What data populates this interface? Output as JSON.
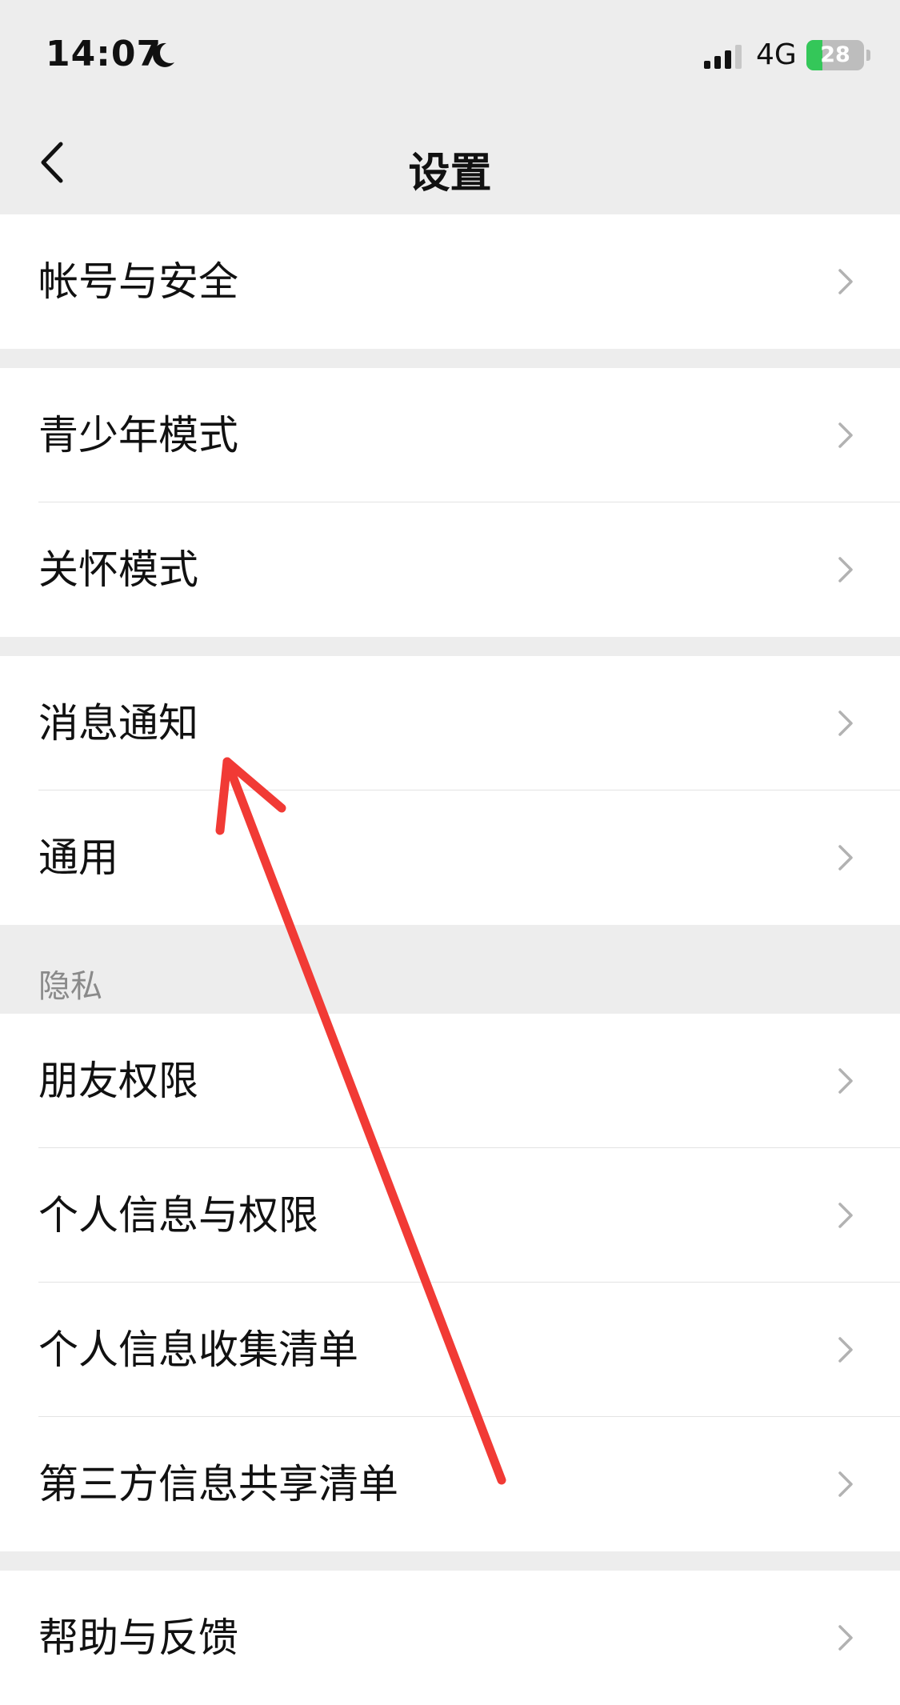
{
  "status_bar": {
    "time": "14:07",
    "moon_icon": "moon-icon",
    "signal_icon": "cellular-signal-icon",
    "network": "4G",
    "battery": {
      "text": "28",
      "level": 0.28,
      "color": "#34c759",
      "icon": "battery-charging-icon"
    }
  },
  "nav": {
    "title": "设置",
    "back_icon": "chevron-left-icon"
  },
  "groups": [
    {
      "items": [
        {
          "label": "帐号与安全"
        }
      ]
    },
    {
      "items": [
        {
          "label": "青少年模式"
        },
        {
          "label": "关怀模式"
        }
      ]
    },
    {
      "items": [
        {
          "label": "消息通知"
        },
        {
          "label": "通用"
        }
      ]
    },
    {
      "section_label": "隐私",
      "items": [
        {
          "label": "朋友权限"
        },
        {
          "label": "个人信息与权限"
        },
        {
          "label": "个人信息收集清单"
        },
        {
          "label": "第三方信息共享清单"
        }
      ]
    },
    {
      "items": [
        {
          "label": "帮助与反馈"
        }
      ]
    }
  ],
  "annotation": {
    "icon": "red-arrow-annotation",
    "color": "#f13a35"
  },
  "colors": {
    "background": "#ededed",
    "card": "#ffffff",
    "chevron": "#b2b2b2"
  }
}
